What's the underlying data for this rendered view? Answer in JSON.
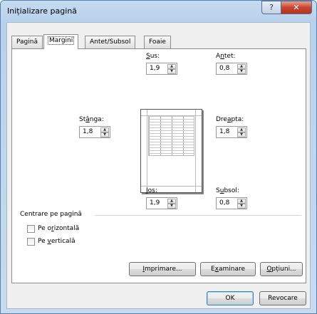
{
  "window": {
    "title": "Inițializare pagină",
    "help_label": "?",
    "close_label": "✕"
  },
  "tabs": [
    {
      "label": "Pagină",
      "active": false
    },
    {
      "label": "Margini",
      "active": true
    },
    {
      "label": "Antet/Subsol",
      "active": false
    },
    {
      "label": "Foaie",
      "active": false
    }
  ],
  "margins": {
    "top": {
      "label_pre": "",
      "label_key": "S",
      "label_post": "us:",
      "value": "1,9"
    },
    "header": {
      "label_pre": "A",
      "label_key": "n",
      "label_post": "tet:",
      "value": "0,8"
    },
    "left": {
      "label_pre": "St",
      "label_key": "â",
      "label_post": "nga:",
      "value": "1,8"
    },
    "right": {
      "label_pre": "Dre",
      "label_key": "a",
      "label_post": "pta:",
      "value": "1,8"
    },
    "bottom": {
      "label_pre": "",
      "label_key": "J",
      "label_post": "os:",
      "value": "1,9"
    },
    "footer": {
      "label_pre": "S",
      "label_key": "u",
      "label_post": "bsol:",
      "value": "0,8"
    }
  },
  "center": {
    "title": "Centrare pe pagină",
    "horizontal": {
      "label_pre": "Pe o",
      "label_key": "r",
      "label_post": "izontală",
      "checked": false
    },
    "vertical": {
      "label_pre": "Pe ",
      "label_key": "v",
      "label_post": "erticală",
      "checked": false
    }
  },
  "buttons": {
    "print": {
      "label_pre": "",
      "label_key": "I",
      "label_post": "mprimare..."
    },
    "preview": {
      "label_pre": "E",
      "label_key": "x",
      "label_post": "aminare"
    },
    "options": {
      "label_pre": "",
      "label_key": "O",
      "label_post": "pțiuni..."
    },
    "ok": "OK",
    "cancel": "Revocare"
  }
}
